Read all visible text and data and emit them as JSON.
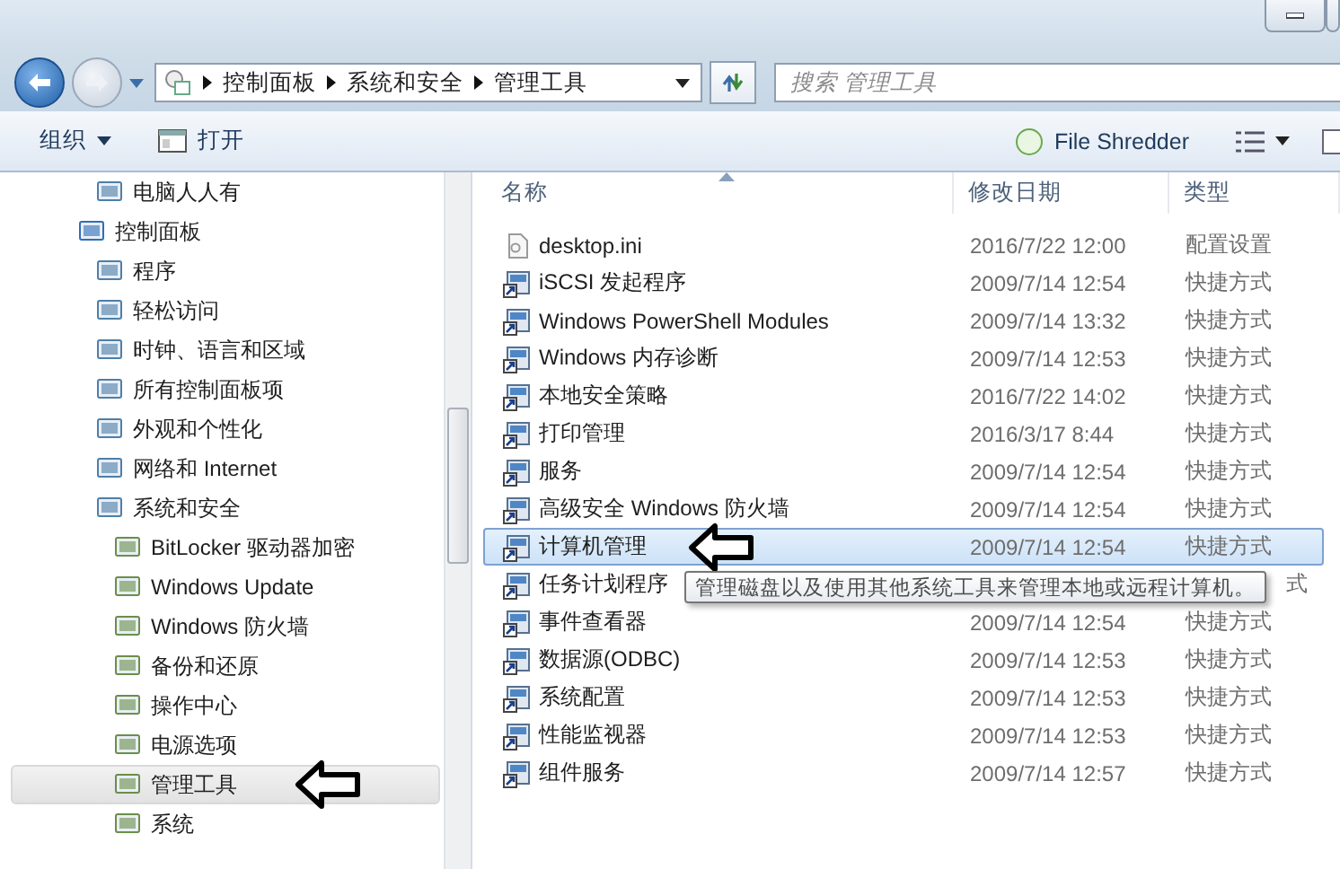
{
  "address_bar": {
    "breadcrumbs": [
      "控制面板",
      "系统和安全",
      "管理工具"
    ],
    "search": {
      "placeholder": "搜索 管理工具"
    }
  },
  "toolbar": {
    "left": [
      {
        "label": "组织",
        "kind": "menu"
      },
      {
        "label": "打开",
        "kind": "open"
      }
    ],
    "right": [
      {
        "label": "File Shredder",
        "kind": "app"
      }
    ]
  },
  "navigation": {
    "partial_children": [
      {
        "label": "电脑人人有",
        "selected": false
      }
    ],
    "items": [
      {
        "label": "控制面板",
        "selected": false,
        "children": [
          {
            "label": "程序",
            "selected": false
          },
          {
            "label": "轻松访问",
            "selected": false
          },
          {
            "label": "时钟、语言和区域",
            "selected": false
          },
          {
            "label": "所有控制面板项",
            "selected": false
          },
          {
            "label": "外观和个性化",
            "selected": false
          },
          {
            "label": "网络和 Internet",
            "selected": false
          },
          {
            "label": "系统和安全",
            "selected": false,
            "children": [
              {
                "label": "BitLocker 驱动器加密",
                "selected": false
              },
              {
                "label": "Windows Update",
                "selected": false
              },
              {
                "label": "Windows 防火墙",
                "selected": false
              },
              {
                "label": "备份和还原",
                "selected": false
              },
              {
                "label": "操作中心",
                "selected": false
              },
              {
                "label": "电源选项",
                "selected": false
              },
              {
                "label": "管理工具",
                "selected": true
              },
              {
                "label": "系统",
                "selected": false
              }
            ]
          }
        ]
      }
    ]
  },
  "file_list": {
    "columns": [
      "名称",
      "修改日期",
      "类型"
    ],
    "rows": [
      {
        "name": "desktop.ini",
        "date": "2016/7/22 12:00",
        "type": "配置设置",
        "selected": false
      },
      {
        "name": "iSCSI 发起程序",
        "date": "2009/7/14 12:54",
        "type": "快捷方式",
        "selected": false
      },
      {
        "name": "Windows PowerShell Modules",
        "date": "2009/7/14 13:32",
        "type": "快捷方式",
        "selected": false
      },
      {
        "name": "Windows 内存诊断",
        "date": "2009/7/14 12:53",
        "type": "快捷方式",
        "selected": false
      },
      {
        "name": "本地安全策略",
        "date": "2016/7/22 14:02",
        "type": "快捷方式",
        "selected": false
      },
      {
        "name": "打印管理",
        "date": "2016/3/17 8:44",
        "type": "快捷方式",
        "selected": false
      },
      {
        "name": "服务",
        "date": "2009/7/14 12:54",
        "type": "快捷方式",
        "selected": false
      },
      {
        "name": "高级安全 Windows 防火墙",
        "date": "2009/7/14 12:54",
        "type": "快捷方式",
        "selected": false
      },
      {
        "name": "计算机管理",
        "date": "2009/7/14 12:54",
        "type": "快捷方式",
        "selected": true
      },
      {
        "name": "任务计划程序",
        "type": "式",
        "selected": false,
        "covered": true
      },
      {
        "name": "事件查看器",
        "date": "2009/7/14 12:54",
        "type": "快捷方式",
        "selected": false
      },
      {
        "name": "数据源(ODBC)",
        "date": "2009/7/14 12:53",
        "type": "快捷方式",
        "selected": false
      },
      {
        "name": "系统配置",
        "date": "2009/7/14 12:53",
        "type": "快捷方式",
        "selected": false
      },
      {
        "name": "性能监视器",
        "date": "2009/7/14 12:53",
        "type": "快捷方式",
        "selected": false
      },
      {
        "name": "组件服务",
        "date": "2009/7/14 12:57",
        "type": "快捷方式",
        "selected": false
      }
    ],
    "tooltip": "管理磁盘以及使用其他系统工具来管理本地或远程计算机。"
  }
}
